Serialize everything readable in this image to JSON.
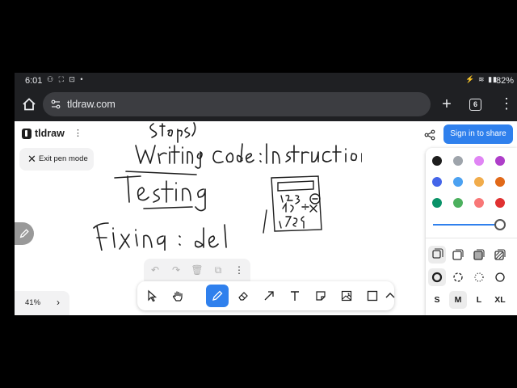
{
  "status_bar": {
    "time": "6:01",
    "battery": "82%"
  },
  "browser": {
    "url": "tldraw.com",
    "tab_count": "6"
  },
  "app": {
    "logo_text": "tldraw",
    "exit_pen_label": "Exit pen mode",
    "share_label": "Sign in to share"
  },
  "colors": {
    "swatches": [
      "#1d1d1d",
      "#9ea4ab",
      "#e085f4",
      "#ae3ec9",
      "#4465e9",
      "#4ba1f1",
      "#f1ac4b",
      "#e16919",
      "#099268",
      "#4cb05e",
      "#f87777",
      "#e03131"
    ],
    "selected": "#1d1d1d",
    "accent": "#2f80ed"
  },
  "style_panel": {
    "opacity": 1.0,
    "sizes": [
      "S",
      "M",
      "L",
      "XL"
    ],
    "selected_size": "M"
  },
  "zoom": {
    "level": "41%"
  },
  "toolbar": {
    "tools": [
      "select-tool",
      "hand-tool",
      "draw-tool",
      "eraser-tool",
      "arrow-tool",
      "text-tool",
      "note-tool",
      "image-tool",
      "rectangle-tool",
      "more-tools"
    ],
    "active": "draw-tool"
  }
}
